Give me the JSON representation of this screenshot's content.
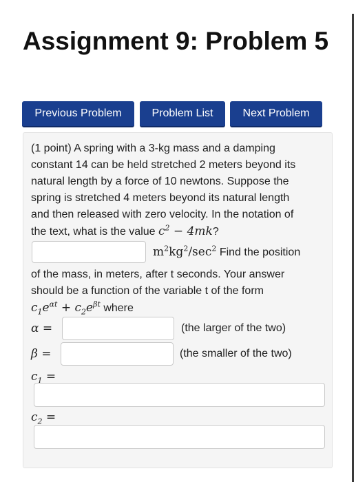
{
  "title": "Assignment 9: Problem 5",
  "nav": {
    "previous": "Previous Problem",
    "list": "Problem List",
    "next": "Next Problem"
  },
  "problem": {
    "line1": "(1 point) A spring with a 3-kg mass and a damping",
    "line2": "constant 14 can be held stretched 2 meters beyond its",
    "line3": "natural length by a force of 10 newtons. Suppose the",
    "line4": "spring is stretched 4 meters beyond its natural length",
    "line5": "and then released with zero velocity. In the notation of",
    "line6_prefix": "the text, what is the value",
    "find_position": "Find the position",
    "line8": "of the mass, in meters, after t seconds. Your answer",
    "line9": "should be a function of the variable t of the form",
    "where": "where",
    "alpha_note": "(the larger of the two)",
    "beta_note": "(the smaller of the two)"
  },
  "inputs": {
    "value_answer": "",
    "alpha": "",
    "beta": "",
    "c1": "",
    "c2": ""
  }
}
